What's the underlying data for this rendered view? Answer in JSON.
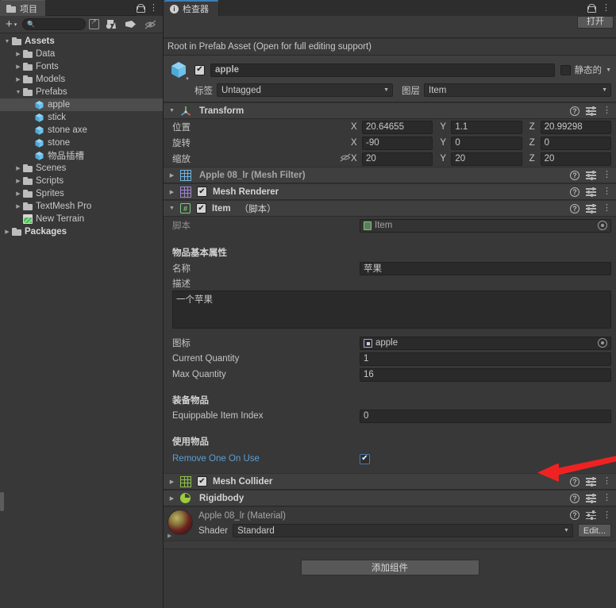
{
  "project_panel": {
    "tab_label": "项目",
    "tab_icon": "folder-icon",
    "lock_icon": "lock-icon",
    "menu_icon": "kebab-menu-icon",
    "toolbar": {
      "add_label": "+",
      "add_caret": "▾",
      "search_placeholder": "",
      "search_value": "",
      "search_icon": "search-icon",
      "save_search_icon": "save-search-icon",
      "favorites_icon": "favorites-icon",
      "label_icon": "label-icon",
      "visibility_icon": "visibility-off-icon"
    },
    "tree": [
      {
        "label": "Assets",
        "indent": 0,
        "arrow": "down",
        "icon": "folder-open-icon",
        "bold": true,
        "selected": false
      },
      {
        "label": "Data",
        "indent": 1,
        "arrow": "right",
        "icon": "folder-icon",
        "bold": false,
        "selected": false
      },
      {
        "label": "Fonts",
        "indent": 1,
        "arrow": "right",
        "icon": "folder-icon",
        "bold": false,
        "selected": false
      },
      {
        "label": "Models",
        "indent": 1,
        "arrow": "right",
        "icon": "folder-icon",
        "bold": false,
        "selected": false
      },
      {
        "label": "Prefabs",
        "indent": 1,
        "arrow": "down",
        "icon": "folder-open-icon",
        "bold": false,
        "selected": false
      },
      {
        "label": "apple",
        "indent": 2,
        "arrow": "none",
        "icon": "prefab-cube-icon",
        "bold": false,
        "selected": true
      },
      {
        "label": "stick",
        "indent": 2,
        "arrow": "none",
        "icon": "prefab-cube-icon",
        "bold": false,
        "selected": false
      },
      {
        "label": "stone axe",
        "indent": 2,
        "arrow": "none",
        "icon": "prefab-cube-icon",
        "bold": false,
        "selected": false
      },
      {
        "label": "stone",
        "indent": 2,
        "arrow": "none",
        "icon": "prefab-cube-icon",
        "bold": false,
        "selected": false
      },
      {
        "label": "物品插槽",
        "indent": 2,
        "arrow": "none",
        "icon": "prefab-cube-icon",
        "bold": false,
        "selected": false
      },
      {
        "label": "Scenes",
        "indent": 1,
        "arrow": "right",
        "icon": "folder-icon",
        "bold": false,
        "selected": false
      },
      {
        "label": "Scripts",
        "indent": 1,
        "arrow": "right",
        "icon": "folder-icon",
        "bold": false,
        "selected": false
      },
      {
        "label": "Sprites",
        "indent": 1,
        "arrow": "right",
        "icon": "folder-icon",
        "bold": false,
        "selected": false
      },
      {
        "label": "TextMesh Pro",
        "indent": 1,
        "arrow": "right",
        "icon": "folder-icon",
        "bold": false,
        "selected": false
      },
      {
        "label": "New Terrain",
        "indent": 1,
        "arrow": "none",
        "icon": "terrain-icon",
        "bold": false,
        "selected": false
      },
      {
        "label": "Packages",
        "indent": 0,
        "arrow": "right",
        "icon": "folder-icon",
        "bold": true,
        "selected": false
      }
    ]
  },
  "inspector": {
    "tab_label": "检查器",
    "tab_icon": "info-icon",
    "lock_icon": "lock-icon",
    "menu_icon": "kebab-menu-icon",
    "open_button_label": "打开",
    "prefab_notice": "Root in Prefab Asset (Open for full editing support)",
    "object_header": {
      "icon": "prefab-cube-icon",
      "enabled_checkbox": true,
      "name": "apple",
      "static_checkbox": false,
      "static_label": "静态的",
      "static_caret": "▾",
      "tag_label": "标签",
      "tag_value": "Untagged",
      "layer_label": "图层",
      "layer_value": "Item"
    },
    "transform": {
      "title": "Transform",
      "icon": "transform-axes-icon",
      "foldout": "down",
      "rows": [
        {
          "label": "位置",
          "x": "20.64655",
          "y": "1.1",
          "z": "20.99298",
          "eye": false
        },
        {
          "label": "旋转",
          "x": "-90",
          "y": "0",
          "z": "0",
          "eye": false
        },
        {
          "label": "缩放",
          "x": "20",
          "y": "20",
          "z": "20",
          "eye": true
        }
      ],
      "axis_labels": [
        "X",
        "Y",
        "Z"
      ],
      "help_icon": "help-icon",
      "preset_icon": "preset-icon",
      "menu_icon": "kebab-menu-icon"
    },
    "components": [
      {
        "title": "Apple 08_lr (Mesh Filter)",
        "icon": "mesh-filter-icon",
        "foldout": "right",
        "checkbox": null,
        "dim": true
      },
      {
        "title": "Mesh Renderer",
        "icon": "mesh-renderer-icon",
        "foldout": "right",
        "checkbox": true,
        "dim": false
      }
    ],
    "item_component": {
      "title": "Item",
      "suffix": "（脚本）",
      "icon": "csharp-script-icon",
      "foldout": "down",
      "checkbox": true,
      "script_row": {
        "label": "脚本",
        "value": "Item",
        "icon": "script-asset-icon",
        "picker": "object-picker-icon"
      },
      "basic_section_header": "物品基本属性",
      "name_label": "名称",
      "name_value": "苹果",
      "desc_label": "描述",
      "desc_value": "一个苹果",
      "icon_label": "图标",
      "icon_value": "apple",
      "icon_asset_icon": "sprite-asset-icon",
      "icon_picker": "object-picker-icon",
      "current_quantity_label": "Current Quantity",
      "current_quantity_value": "1",
      "max_quantity_label": "Max Quantity",
      "max_quantity_value": "16",
      "equip_section_header": "装备物品",
      "equippable_index_label": "Equippable Item Index",
      "equippable_index_value": "0",
      "use_section_header": "使用物品",
      "remove_on_use_label": "Remove One On Use",
      "remove_on_use_checked": true
    },
    "bottom_components": [
      {
        "title": "Mesh Collider",
        "icon": "mesh-collider-icon",
        "foldout": "right",
        "checkbox": true
      },
      {
        "title": "Rigidbody",
        "icon": "rigidbody-icon",
        "foldout": "right",
        "checkbox": null
      }
    ],
    "material": {
      "title": "Apple 08_lr (Material)",
      "thumbnail": "material-preview-icon",
      "shader_label": "Shader",
      "shader_value": "Standard",
      "edit_label": "Edit...",
      "foldout": "right",
      "help_icon": "help-icon",
      "preset_icon": "preset-icon",
      "menu_icon": "kebab-menu-icon"
    },
    "add_component_label": "添加组件"
  },
  "annotation": {
    "arrow_color": "#ee2222",
    "target": "remove-one-on-use-checkbox"
  },
  "colors": {
    "panel_bg": "#383838",
    "header_bg": "#3f3f3f",
    "field_bg": "#2a2a2a",
    "accent_blue": "#3d7eb8",
    "link_blue": "#5b9fd4",
    "selection": "#4d4d4d",
    "annotation_red": "#ee2222"
  }
}
